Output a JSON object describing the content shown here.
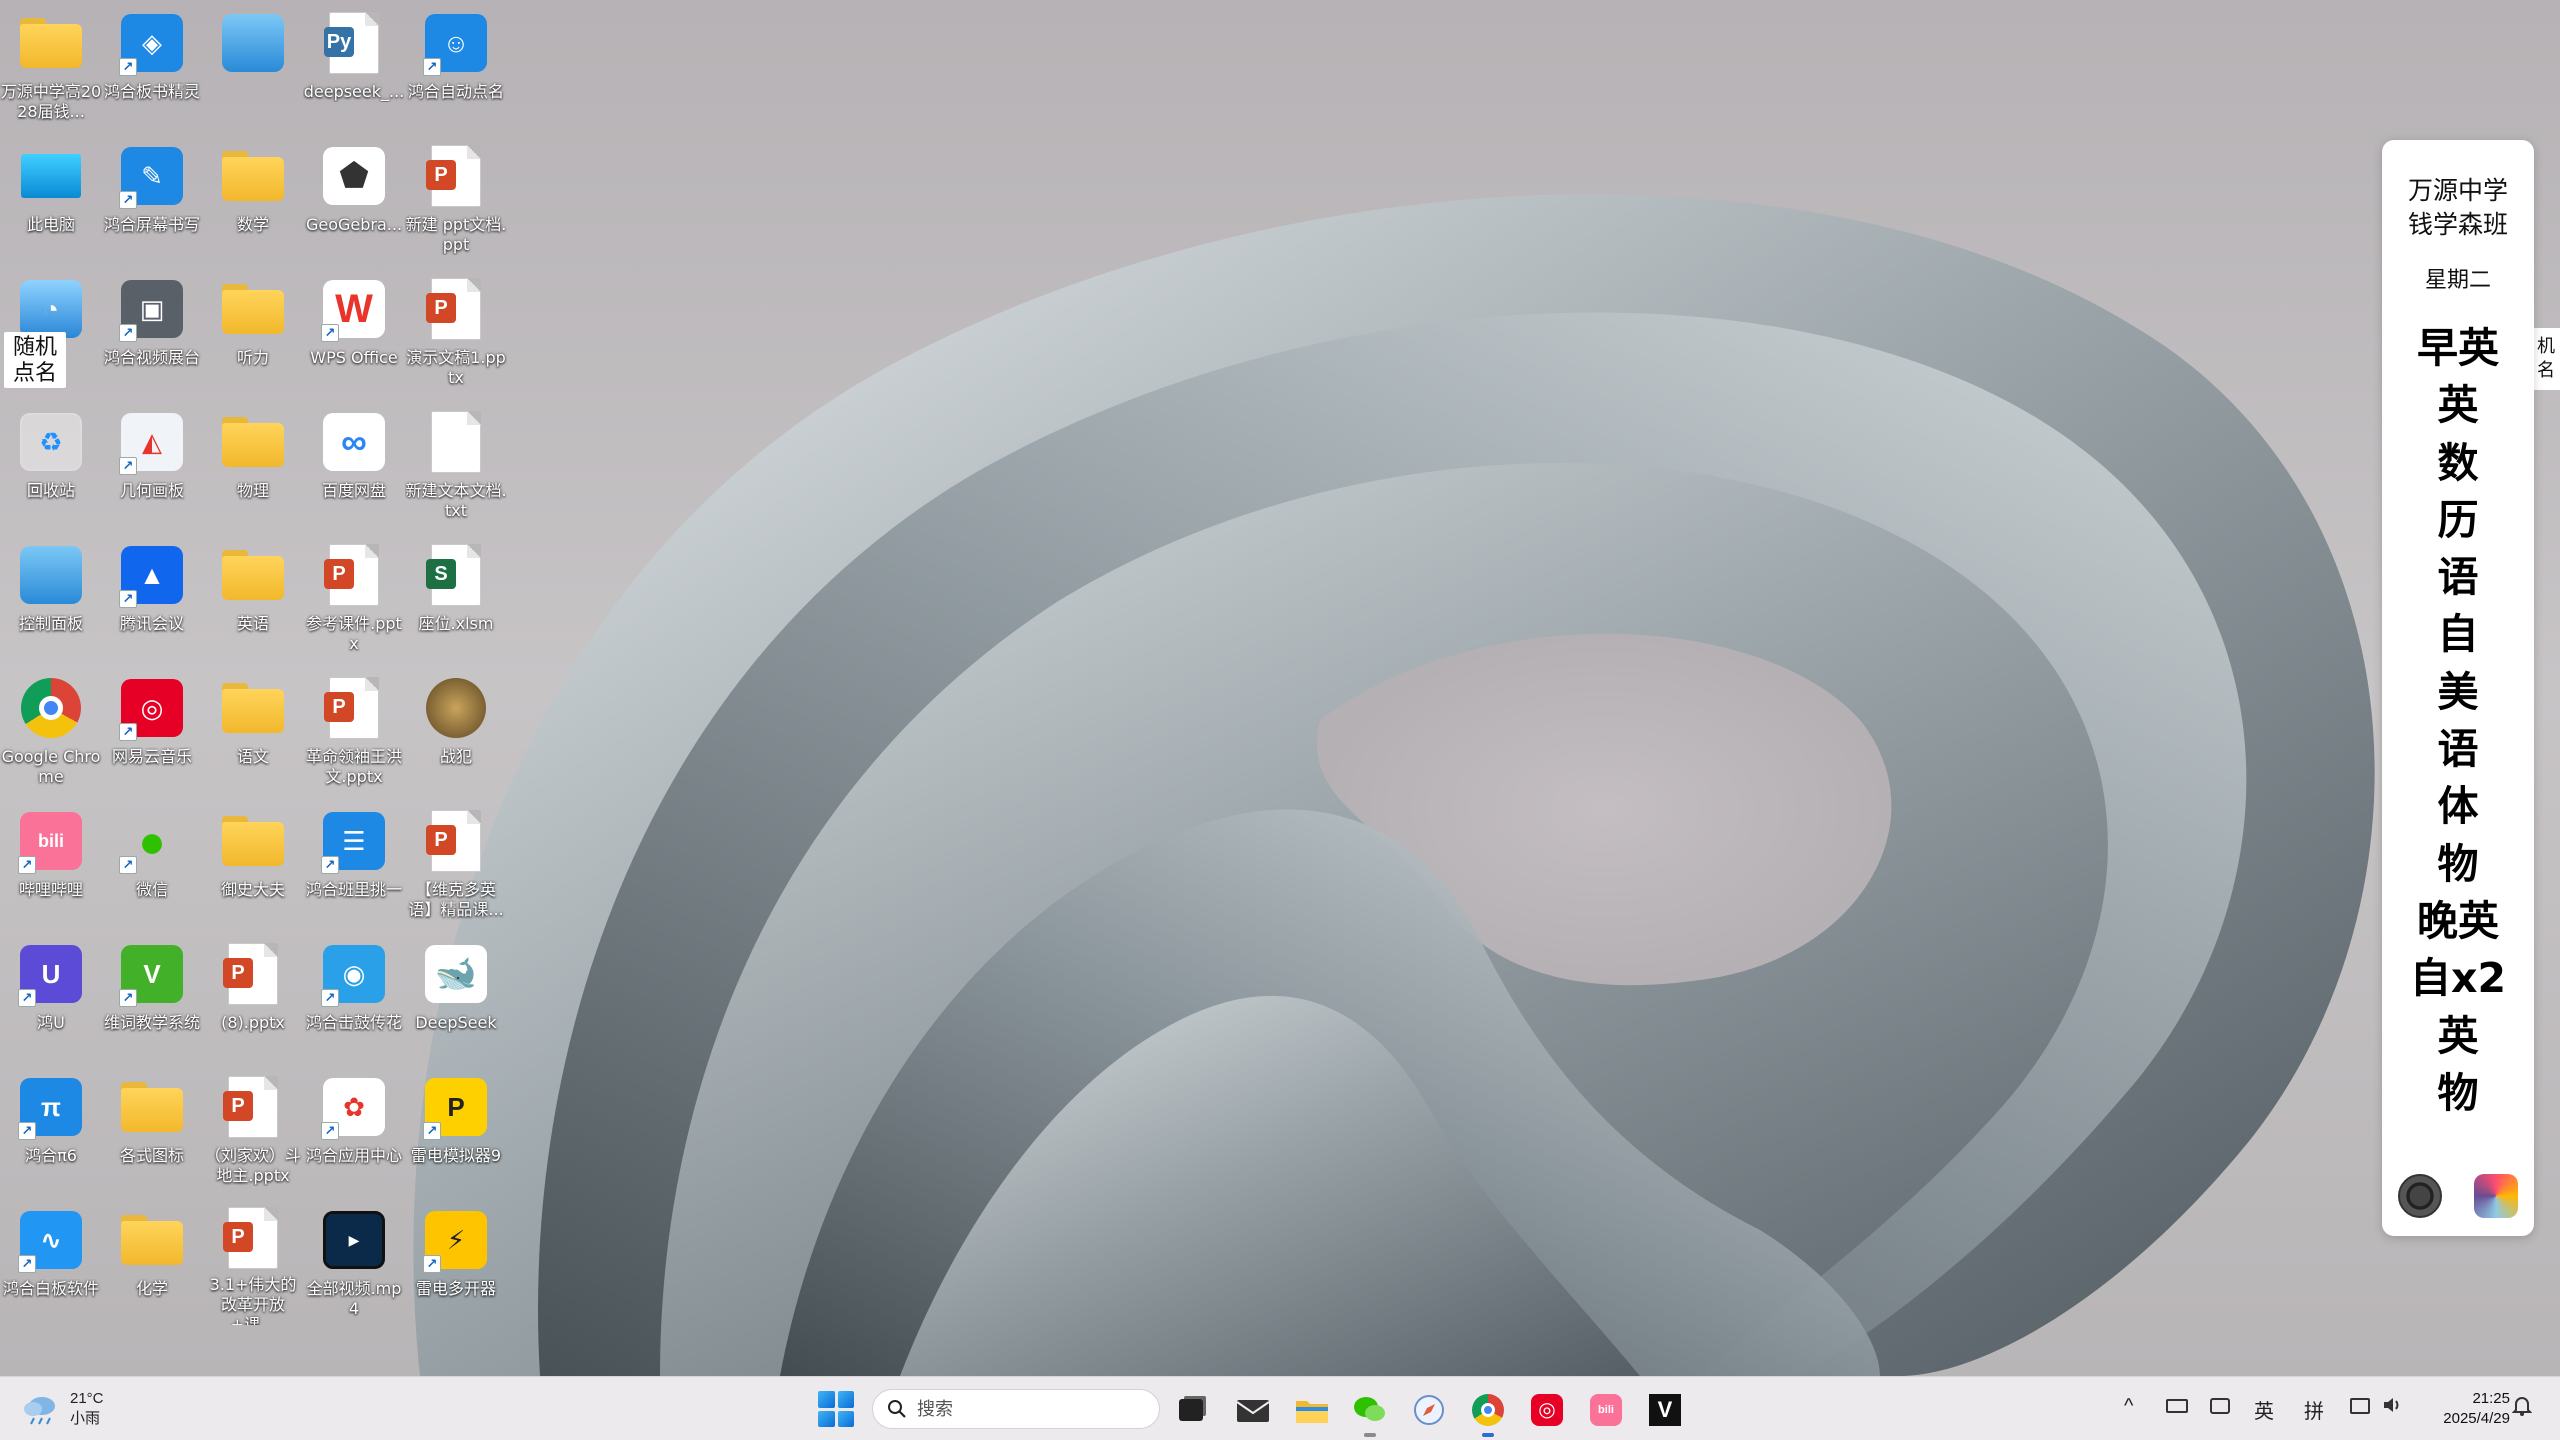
{
  "desktop": {
    "icons": [
      {
        "label": "万源中学高2028届钱...",
        "kind": "user-folder-icon",
        "shortcut": false
      },
      {
        "label": "鸿合板书精灵",
        "kind": "blackboard-sprite-icon",
        "shortcut": true
      },
      {
        "label": "",
        "kind": "control-panel-icon",
        "shortcut": false
      },
      {
        "label": "deepseek_...",
        "kind": "python-file-icon",
        "shortcut": false
      },
      {
        "label": "鸿合自动点名",
        "kind": "auto-rollcall-icon",
        "shortcut": true
      },
      {
        "label": "此电脑",
        "kind": "this-pc-icon",
        "shortcut": false
      },
      {
        "label": "鸿合屏幕书写",
        "kind": "screen-writing-icon",
        "shortcut": true
      },
      {
        "label": "数学",
        "kind": "folder-icon",
        "shortcut": false
      },
      {
        "label": "GeoGebra...",
        "kind": "geogebra-icon",
        "shortcut": false
      },
      {
        "label": "新建 ppt文档.ppt",
        "kind": "ppt-file-icon",
        "shortcut": false
      },
      {
        "label": "",
        "kind": "network-globe-icon",
        "shortcut": false
      },
      {
        "label": "鸿合视频展台",
        "kind": "video-booth-icon",
        "shortcut": true
      },
      {
        "label": "听力",
        "kind": "folder-icon",
        "shortcut": false
      },
      {
        "label": "WPS Office",
        "kind": "wps-office-icon",
        "shortcut": true
      },
      {
        "label": "演示文稿1.pptx",
        "kind": "ppt-file-icon",
        "shortcut": false
      },
      {
        "label": "回收站",
        "kind": "recycle-bin-icon",
        "shortcut": false
      },
      {
        "label": "几何画板",
        "kind": "geometry-sketchpad-icon",
        "shortcut": true
      },
      {
        "label": "物理",
        "kind": "folder-icon",
        "shortcut": false
      },
      {
        "label": "百度网盘",
        "kind": "baidu-netdisk-icon",
        "shortcut": false
      },
      {
        "label": "新建文本文档.txt",
        "kind": "text-file-icon",
        "shortcut": false
      },
      {
        "label": "控制面板",
        "kind": "control-panel-icon",
        "shortcut": false
      },
      {
        "label": "腾讯会议",
        "kind": "tencent-meeting-icon",
        "shortcut": true
      },
      {
        "label": "英语",
        "kind": "folder-icon",
        "shortcut": false
      },
      {
        "label": "参考课件.pptx",
        "kind": "ppt-file-icon",
        "shortcut": false
      },
      {
        "label": "座位.xlsm",
        "kind": "excel-file-icon",
        "shortcut": false
      },
      {
        "label": "Google Chrome",
        "kind": "chrome-icon",
        "shortcut": false
      },
      {
        "label": "网易云音乐",
        "kind": "netease-music-icon",
        "shortcut": true
      },
      {
        "label": "语文",
        "kind": "folder-icon",
        "shortcut": false
      },
      {
        "label": "革命领袖王洪文.pptx",
        "kind": "ppt-file-icon",
        "shortcut": false
      },
      {
        "label": "战犯",
        "kind": "coin-image-icon",
        "shortcut": false
      },
      {
        "label": "哔哩哔哩",
        "kind": "bilibili-icon",
        "shortcut": true
      },
      {
        "label": "微信",
        "kind": "wechat-icon",
        "shortcut": true
      },
      {
        "label": "御史大夫",
        "kind": "folder-icon",
        "shortcut": false
      },
      {
        "label": "鸿合班里挑一",
        "kind": "class-pick-icon",
        "shortcut": true
      },
      {
        "label": "【维克多英语】精品课...",
        "kind": "ppt-file-icon",
        "shortcut": false
      },
      {
        "label": "鸿U",
        "kind": "hong-u-icon",
        "shortcut": true
      },
      {
        "label": "维词教学系统",
        "kind": "weici-teacher-icon",
        "shortcut": true
      },
      {
        "label": "(8).pptx",
        "kind": "ppt-file-icon",
        "shortcut": false
      },
      {
        "label": "鸿合击鼓传花",
        "kind": "drum-flower-icon",
        "shortcut": true
      },
      {
        "label": "DeepSeek",
        "kind": "deepseek-icon",
        "shortcut": false
      },
      {
        "label": "鸿合π6",
        "kind": "hong-pi-icon",
        "shortcut": true
      },
      {
        "label": "各式图标",
        "kind": "folder-icon",
        "shortcut": false
      },
      {
        "label": "（刘家欢）斗地主.pptx",
        "kind": "ppt-file-icon",
        "shortcut": false
      },
      {
        "label": "鸿合应用中心",
        "kind": "app-center-icon",
        "shortcut": true
      },
      {
        "label": "雷电模拟器9",
        "kind": "ldplayer-icon",
        "shortcut": true
      },
      {
        "label": "鸿合白板软件",
        "kind": "whiteboard-icon",
        "shortcut": true
      },
      {
        "label": "化学",
        "kind": "folder-icon",
        "shortcut": false
      },
      {
        "label": "3.1+伟大的改革开放+课...",
        "kind": "ppt-file-icon",
        "shortcut": false
      },
      {
        "label": "全部视频.mp4",
        "kind": "video-file-icon",
        "shortcut": false
      },
      {
        "label": "雷电多开器",
        "kind": "ldmulti-icon",
        "shortcut": true
      }
    ],
    "random_pick_label": "随机点名",
    "edge_tab_label": "机名"
  },
  "schedule": {
    "class_name": "万源中学钱学森班",
    "weekday": "星期二",
    "periods": [
      "早英",
      "英",
      "数",
      "历",
      "语",
      "自",
      "美",
      "语",
      "体",
      "物",
      "晚英",
      "自x2",
      "英",
      "物"
    ],
    "buttons": [
      "settings-icon",
      "app-logo-icon"
    ]
  },
  "taskbar": {
    "weather": {
      "temp": "21°C",
      "condition": "小雨"
    },
    "search_placeholder": "搜索",
    "apps": [
      "task-view-icon",
      "mail-icon",
      "file-explorer-icon",
      "wechat-icon",
      "safari-like-icon",
      "chrome-icon",
      "netease-music-icon",
      "bilibili-icon",
      "v-app-icon"
    ],
    "tray": {
      "chevron": "^",
      "ime_lang": "英",
      "ime_mode": "拼"
    },
    "clock": {
      "time": "21:25",
      "date": "2025/4/29"
    }
  },
  "colors": {
    "accent": "#0a6bd6",
    "folder": "#f2b82c",
    "ppt": "#d24726",
    "excel": "#1d7044",
    "taskbar_bg": "#eeecee"
  }
}
